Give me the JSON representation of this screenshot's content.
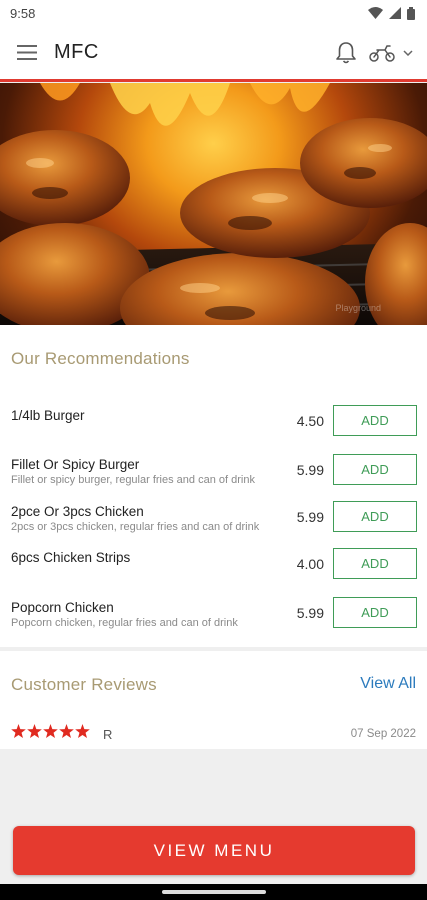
{
  "status_bar": {
    "time": "9:58"
  },
  "app_bar": {
    "title": "MFC"
  },
  "hero": {
    "watermark": "Playground"
  },
  "recommendations": {
    "title": "Our Recommendations",
    "items": [
      {
        "name": "1/4lb Burger",
        "description": "",
        "price": "4.50",
        "button": "ADD"
      },
      {
        "name": "Fillet Or Spicy Burger",
        "description": "Fillet or spicy burger, regular fries and can of drink",
        "price": "5.99",
        "button": "ADD"
      },
      {
        "name": "2pce Or 3pcs Chicken",
        "description": "2pcs or 3pcs chicken, regular fries and can of drink",
        "price": "5.99",
        "button": "ADD"
      },
      {
        "name": "6pcs Chicken Strips",
        "description": "",
        "price": "4.00",
        "button": "ADD"
      },
      {
        "name": "Popcorn Chicken",
        "description": "Popcorn chicken, regular fries and can of drink",
        "price": "5.99",
        "button": "ADD"
      }
    ]
  },
  "reviews": {
    "title": "Customer Reviews",
    "view_all": "View All",
    "latest": {
      "rating": 5,
      "reviewer": "R",
      "date": "07 Sep 2022"
    }
  },
  "footer": {
    "view_menu": "VIEW MENU"
  },
  "colors": {
    "accent": "#e53a2f",
    "add_green": "#3f9c57",
    "link_blue": "#2c7bbd",
    "section_gold": "#a89a73"
  },
  "icons": [
    "menu-icon",
    "bell-icon",
    "scooter-icon",
    "chevron-down-icon",
    "star-icon",
    "wifi-icon",
    "signal-icon",
    "battery-icon"
  ]
}
